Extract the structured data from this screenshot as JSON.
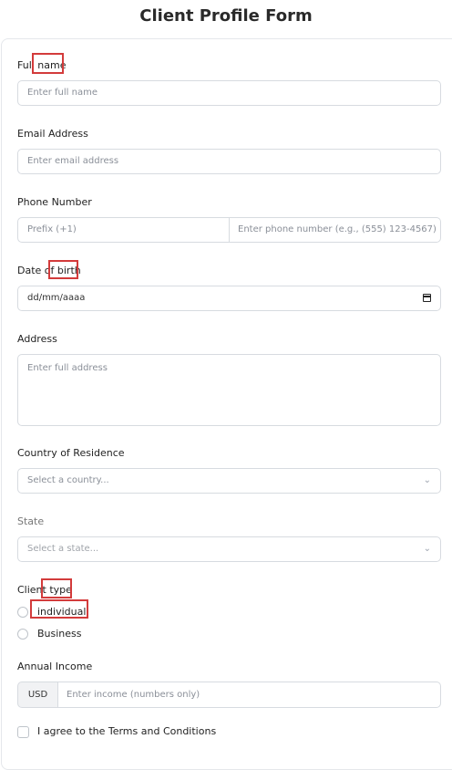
{
  "form": {
    "title": "Client Profile Form",
    "full_name": {
      "label": "Full name",
      "placeholder": "Enter full name"
    },
    "email": {
      "label": "Email Address",
      "placeholder": "Enter email address"
    },
    "phone": {
      "label": "Phone Number",
      "prefix_placeholder": "Prefix (+1)",
      "number_placeholder": "Enter phone number (e.g., (555) 123-4567)"
    },
    "dob": {
      "label": "Date of birth",
      "placeholder": "dd/mm/aaaa"
    },
    "address": {
      "label": "Address",
      "placeholder": "Enter full address"
    },
    "country": {
      "label": "Country of Residence",
      "placeholder": "Select a country..."
    },
    "state": {
      "label": "State",
      "placeholder": "Select a state..."
    },
    "client_type": {
      "label": "Client type",
      "options": [
        "individual",
        "Business"
      ]
    },
    "income": {
      "label": "Annual Income",
      "currency": "USD",
      "placeholder": "Enter income (numbers only)"
    },
    "terms": {
      "label": "I agree to the Terms and Conditions"
    }
  },
  "highlight_color": "#d33b3b"
}
